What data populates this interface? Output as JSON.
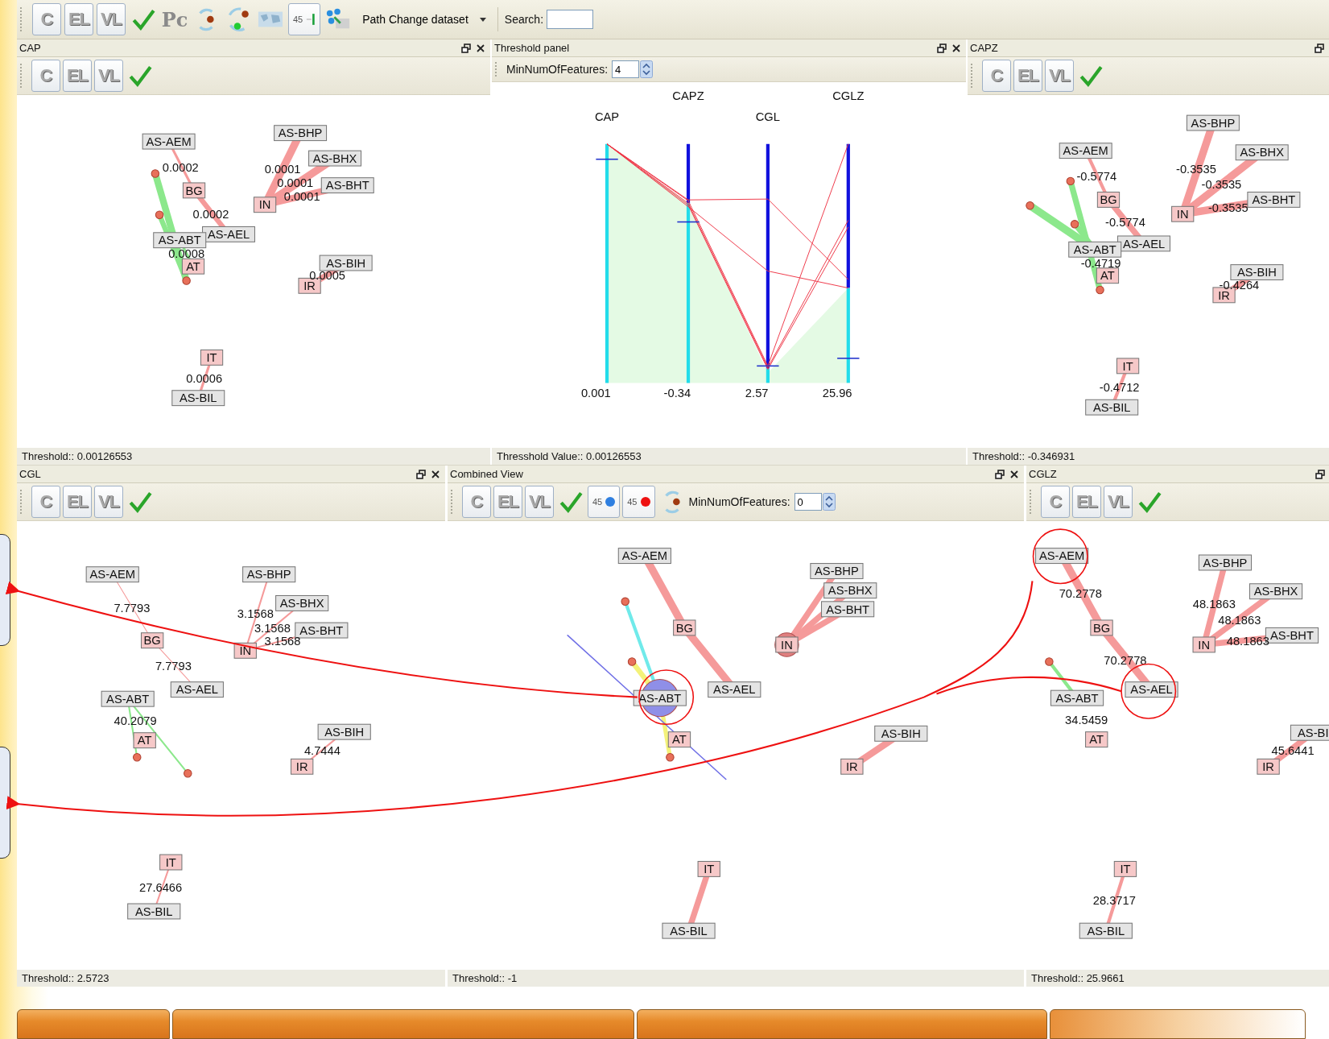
{
  "toolbar": [
    {
      "kind": "letter",
      "text": "C"
    },
    {
      "kind": "letter",
      "text": "EL"
    },
    {
      "kind": "letter",
      "text": "VL"
    },
    {
      "kind": "check"
    },
    {
      "kind": "faint",
      "text": "Pc"
    },
    {
      "kind": "cycle"
    },
    {
      "kind": "cluster"
    },
    {
      "kind": "map"
    },
    {
      "kind": "slider",
      "text": "45"
    },
    {
      "kind": "network"
    },
    {
      "kind": "dropdown",
      "text": "Path Change dataset"
    },
    {
      "kind": "search",
      "text": "Search:"
    }
  ],
  "rows": [
    [
      {
        "kind": "graph",
        "title": "CAP",
        "controls": [
          {
            "kind": "restore"
          },
          {
            "kind": "close"
          }
        ],
        "tools": [
          {
            "kind": "letter",
            "text": "C"
          },
          {
            "kind": "letter",
            "text": "EL"
          },
          {
            "kind": "letter",
            "text": "VL"
          },
          {
            "kind": "check"
          }
        ],
        "nodes": [
          {
            "label": "AS-AEM",
            "color": "#e4e4e4"
          },
          {
            "label": "BG",
            "color": "#f6c8c8"
          },
          {
            "label": "AS-AEL",
            "color": "#e4e4e4"
          },
          {
            "label": "AS-ABT",
            "color": "#e4e4e4"
          },
          {
            "label": "AT",
            "color": "#f6c8c8"
          },
          {
            "label": "AS-BHP",
            "color": "#e4e4e4"
          },
          {
            "label": "AS-BHX",
            "color": "#e4e4e4"
          },
          {
            "label": "AS-BHT",
            "color": "#e4e4e4"
          },
          {
            "label": "IN",
            "color": "#f6c8c8"
          },
          {
            "label": "AS-BIH",
            "color": "#e4e4e4"
          },
          {
            "label": "IR",
            "color": "#f6c8c8"
          },
          {
            "label": "IT",
            "color": "#f6c8c8"
          },
          {
            "label": "AS-BIL",
            "color": "#e4e4e4"
          }
        ],
        "weights": [
          "0.0002",
          "0.0002",
          "0.0008",
          "0.0001",
          "0.0001",
          "0.0001",
          "0.0005",
          "0.0006"
        ],
        "status": "Threshold:: 0.00126553"
      },
      {
        "kind": "parallel",
        "title": "Threshold panel",
        "controls": [
          {
            "kind": "restore"
          },
          {
            "kind": "close"
          }
        ],
        "tools": [
          {
            "kind": "spinner",
            "text": "MinNumOfFeatures:",
            "value": "4"
          }
        ],
        "axes": [
          {
            "name": "CAP",
            "value": "0.001"
          },
          {
            "name": "CAPZ",
            "value": "-0.34"
          },
          {
            "name": "CGL",
            "value": "2.57"
          },
          {
            "name": "CGLZ",
            "value": "25.96"
          }
        ],
        "status": "Thresshold Value:: 0.00126553"
      },
      {
        "kind": "graph",
        "title": "CAPZ",
        "controls": [
          {
            "kind": "restore"
          }
        ],
        "tools": [
          {
            "kind": "letter",
            "text": "C"
          },
          {
            "kind": "letter",
            "text": "EL"
          },
          {
            "kind": "letter",
            "text": "VL"
          },
          {
            "kind": "check"
          }
        ],
        "nodes": [
          {
            "label": "AS-AEM",
            "color": "#e4e4e4"
          },
          {
            "label": "BG",
            "color": "#f6c8c8"
          },
          {
            "label": "AS-AEL",
            "color": "#e4e4e4"
          },
          {
            "label": "AS-ABT",
            "color": "#e4e4e4"
          },
          {
            "label": "AT",
            "color": "#f6c8c8"
          },
          {
            "label": "AS-BHP",
            "color": "#e4e4e4"
          },
          {
            "label": "AS-BHX",
            "color": "#e4e4e4"
          },
          {
            "label": "AS-BHT",
            "color": "#e4e4e4"
          },
          {
            "label": "IN",
            "color": "#f6c8c8"
          },
          {
            "label": "AS-BIH",
            "color": "#e4e4e4"
          },
          {
            "label": "IR",
            "color": "#f6c8c8"
          },
          {
            "label": "IT",
            "color": "#f6c8c8"
          },
          {
            "label": "AS-BIL",
            "color": "#e4e4e4"
          }
        ],
        "weights": [
          "-0.5774",
          "-0.5774",
          "-0.4719",
          "-0.3535",
          "-0.3535",
          "-0.3535",
          "-0.4264",
          "-0.4712"
        ],
        "status": "Threshold:: -0.346931"
      }
    ],
    [
      {
        "kind": "graph",
        "title": "CGL",
        "controls": [
          {
            "kind": "restore"
          },
          {
            "kind": "close"
          }
        ],
        "tools": [
          {
            "kind": "letter",
            "text": "C"
          },
          {
            "kind": "letter",
            "text": "EL"
          },
          {
            "kind": "letter",
            "text": "VL"
          },
          {
            "kind": "check"
          }
        ],
        "nodes": [
          {
            "label": "AS-AEM",
            "color": "#e4e4e4"
          },
          {
            "label": "BG",
            "color": "#f6c8c8"
          },
          {
            "label": "AS-AEL",
            "color": "#e4e4e4"
          },
          {
            "label": "AS-ABT",
            "color": "#e4e4e4"
          },
          {
            "label": "AT",
            "color": "#f6c8c8"
          },
          {
            "label": "AS-BHP",
            "color": "#e4e4e4"
          },
          {
            "label": "AS-BHX",
            "color": "#e4e4e4"
          },
          {
            "label": "AS-BHT",
            "color": "#e4e4e4"
          },
          {
            "label": "IN",
            "color": "#f6c8c8"
          },
          {
            "label": "AS-BIH",
            "color": "#e4e4e4"
          },
          {
            "label": "IR",
            "color": "#f6c8c8"
          },
          {
            "label": "IT",
            "color": "#f6c8c8"
          },
          {
            "label": "AS-BIL",
            "color": "#e4e4e4"
          }
        ],
        "weights": [
          "7.7793",
          "7.7793",
          "40.2079",
          "3.1568",
          "3.1568",
          "3.1568",
          "4.7444",
          "27.6466"
        ],
        "status": "Threshold:: 2.5723"
      },
      {
        "kind": "graph",
        "title": "Combined View",
        "controls": [
          {
            "kind": "restore"
          },
          {
            "kind": "close"
          }
        ],
        "tools": [
          {
            "kind": "letter",
            "text": "C"
          },
          {
            "kind": "letter",
            "text": "EL"
          },
          {
            "kind": "letter",
            "text": "VL"
          },
          {
            "kind": "check"
          },
          {
            "kind": "count",
            "text": "45",
            "color": "#2f7fe0"
          },
          {
            "kind": "count",
            "text": "45",
            "color": "#ee1111"
          },
          {
            "kind": "cycle"
          },
          {
            "kind": "spinner",
            "text": "MinNumOfFeatures:",
            "value": "0"
          }
        ],
        "nodes": [
          {
            "label": "AS-AEM",
            "color": "#e4e4e4"
          },
          {
            "label": "BG",
            "color": "#f6c8c8"
          },
          {
            "label": "AS-AEL",
            "color": "#e4e4e4"
          },
          {
            "label": "AS-ABT",
            "color": "#e4e4e4"
          },
          {
            "label": "AT",
            "color": "#f6c8c8"
          },
          {
            "label": "AS-BHP",
            "color": "#e4e4e4"
          },
          {
            "label": "AS-BHX",
            "color": "#e4e4e4"
          },
          {
            "label": "AS-BHT",
            "color": "#e4e4e4"
          },
          {
            "label": "IN",
            "color": "#f6c8c8"
          },
          {
            "label": "AS-BIH",
            "color": "#e4e4e4"
          },
          {
            "label": "IR",
            "color": "#f6c8c8"
          },
          {
            "label": "IT",
            "color": "#f6c8c8"
          },
          {
            "label": "AS-BIL",
            "color": "#e4e4e4"
          }
        ],
        "status": "Threshold:: -1"
      },
      {
        "kind": "graph",
        "title": "CGLZ",
        "controls": [
          {
            "kind": "restore"
          }
        ],
        "tools": [
          {
            "kind": "letter",
            "text": "C"
          },
          {
            "kind": "letter",
            "text": "EL"
          },
          {
            "kind": "letter",
            "text": "VL"
          },
          {
            "kind": "check"
          }
        ],
        "nodes": [
          {
            "label": "AS-AEM",
            "color": "#e4e4e4"
          },
          {
            "label": "BG",
            "color": "#f6c8c8"
          },
          {
            "label": "AS-AEL",
            "color": "#e4e4e4"
          },
          {
            "label": "AS-ABT",
            "color": "#e4e4e4"
          },
          {
            "label": "AT",
            "color": "#f6c8c8"
          },
          {
            "label": "AS-BHP",
            "color": "#e4e4e4"
          },
          {
            "label": "AS-BHX",
            "color": "#e4e4e4"
          },
          {
            "label": "AS-BHT",
            "color": "#e4e4e4"
          },
          {
            "label": "IN",
            "color": "#f6c8c8"
          },
          {
            "label": "AS-BI",
            "color": "#e4e4e4"
          },
          {
            "label": "IR",
            "color": "#f6c8c8"
          },
          {
            "label": "IT",
            "color": "#f6c8c8"
          },
          {
            "label": "AS-BIL",
            "color": "#e4e4e4"
          }
        ],
        "weights": [
          "70.2778",
          "70.2778",
          "34.5459",
          "48.1863",
          "48.1863",
          "48.1863",
          "45.6441",
          "28.3717"
        ],
        "status": "Threshold:: 25.9661"
      }
    ]
  ]
}
